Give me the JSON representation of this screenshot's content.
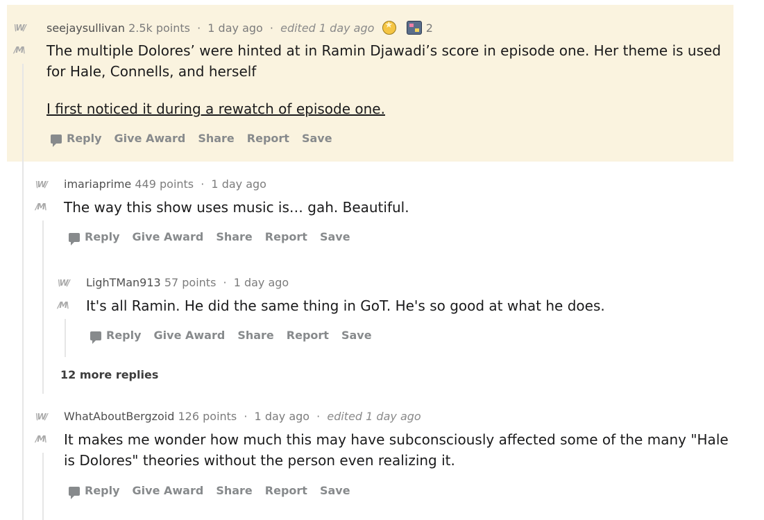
{
  "comments": [
    {
      "author": "seejaysullivan",
      "points": "2.5k points",
      "time": "1 day ago",
      "edited": "edited 1 day ago",
      "award_count": "2",
      "body_line1": "The multiple Dolores’ were hinted at in Ramin Djawadi’s score in episode one. Her theme is used",
      "body_line2": "for Hale, Connells, and herself",
      "link_text": "I first noticed it during a rewatch of episode one."
    },
    {
      "author": "imariaprime",
      "points": "449 points",
      "time": "1 day ago",
      "body_line1": "The way this show uses music is… gah. Beautiful."
    },
    {
      "author": "LighTMan913",
      "points": "57 points",
      "time": "1 day ago",
      "body_line1": "It's all Ramin. He did the same thing in GoT. He's so good at what he does."
    },
    {
      "author": "WhatAboutBergzoid",
      "points": "126 points",
      "time": "1 day ago",
      "edited": "edited 1 day ago",
      "body_line1": "It makes me wonder how much this may have subconsciously affected some of the many \"Hale",
      "body_line2": "is Dolores\" theories without the person even realizing it."
    }
  ],
  "actions": {
    "reply": "Reply",
    "give_award": "Give Award",
    "share": "Share",
    "report": "Report",
    "save": "Save"
  },
  "more_replies": "12 more replies",
  "separator": "·",
  "vote_up": "\\W/",
  "vote_down": "/M\\",
  "colors": {
    "highlight_bg": "#faf3df",
    "thread_line": "#e6e6e6",
    "action_text": "#878a8c"
  }
}
